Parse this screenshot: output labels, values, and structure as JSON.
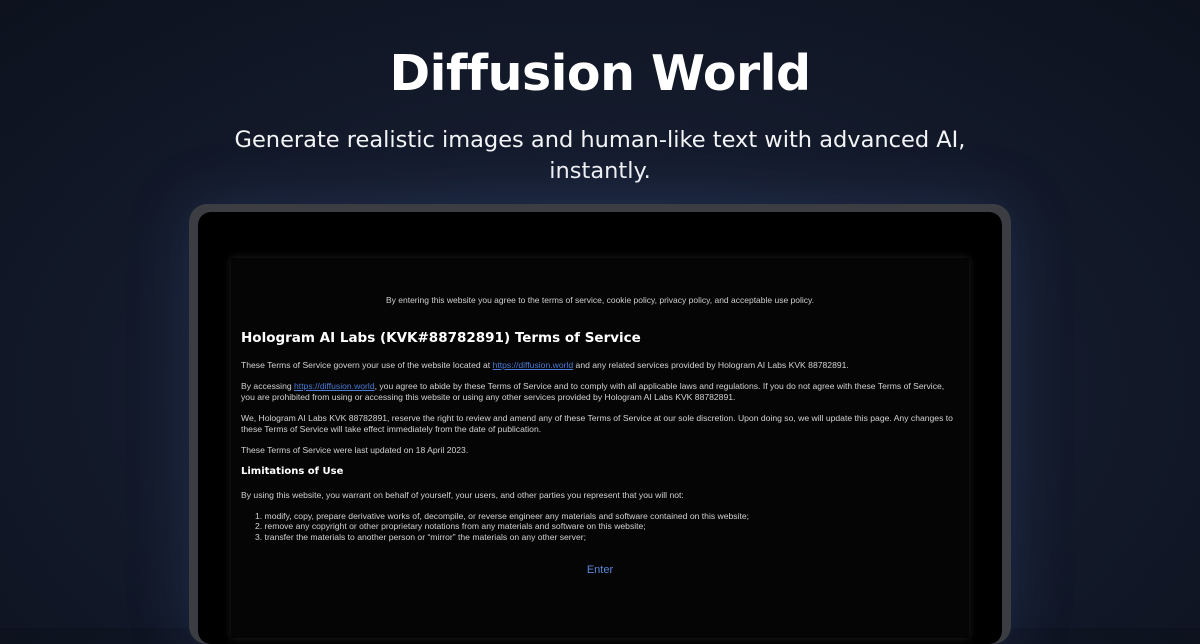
{
  "hero": {
    "title": "Diffusion World",
    "subtitle": "Generate realistic images and human-like text with advanced AI, instantly."
  },
  "modal": {
    "notice": "By entering this website you agree to the terms of service, cookie policy, privacy policy, and acceptable use policy.",
    "heading": "Hologram AI Labs (KVK#88782891) Terms of Service",
    "p1_before": "These Terms of Service govern your use of the website located at ",
    "p1_link": "https://diffusion.world",
    "p1_after": " and any related services provided by Hologram AI Labs KVK 88782891.",
    "p2_before": "By accessing ",
    "p2_link": "https://diffusion.world",
    "p2_after": ", you agree to abide by these Terms of Service and to comply with all applicable laws and regulations. If you do not agree with these Terms of Service, you are prohibited from using or accessing this website or using any other services provided by Hologram AI Labs KVK 88782891.",
    "p3": "We, Hologram AI Labs KVK 88782891, reserve the right to review and amend any of these Terms of Service at our sole discretion. Upon doing so, we will update this page. Any changes to these Terms of Service will take effect immediately from the date of publication.",
    "p4": "These Terms of Service were last updated on 18 April 2023.",
    "subheading": "Limitations of Use",
    "p5": "By using this website, you warrant on behalf of yourself, your users, and other parties you represent that you will not:",
    "list": [
      "1. modify, copy, prepare derivative works of, decompile, or reverse engineer any materials and software contained on this website;",
      "2. remove any copyright or other proprietary notations from any materials and software on this website;",
      "3. transfer the materials to another person or “mirror” the materials on any other server;"
    ],
    "enter_label": "Enter"
  }
}
